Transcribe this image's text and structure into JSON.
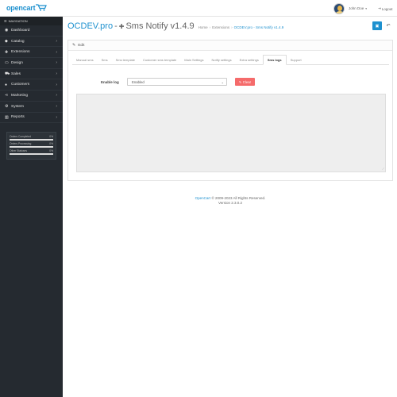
{
  "header": {
    "logo": "opencart",
    "user_name": "John Doe",
    "logout_label": "Logout"
  },
  "sidebar": {
    "nav_title": "NAVIGATION",
    "items": [
      {
        "label": "Dashboard",
        "icon": "dashboard-icon",
        "has_children": false
      },
      {
        "label": "Catalog",
        "icon": "tag-icon",
        "has_children": true
      },
      {
        "label": "Extensions",
        "icon": "puzzle-icon",
        "has_children": true
      },
      {
        "label": "Design",
        "icon": "monitor-icon",
        "has_children": true
      },
      {
        "label": "Sales",
        "icon": "cart-icon",
        "has_children": true
      },
      {
        "label": "Customers",
        "icon": "user-icon",
        "has_children": true
      },
      {
        "label": "Marketing",
        "icon": "share-icon",
        "has_children": true
      },
      {
        "label": "System",
        "icon": "cog-icon",
        "has_children": true
      },
      {
        "label": "Reports",
        "icon": "bar-chart-icon",
        "has_children": true
      }
    ],
    "stats": [
      {
        "label": "Orders Completed",
        "value": "0%",
        "progress": 0
      },
      {
        "label": "Orders Processing",
        "value": "0%",
        "progress": 0
      },
      {
        "label": "Other Statuses",
        "value": "0%",
        "progress": 0
      }
    ]
  },
  "page": {
    "title_brand": "OCDEV.pro",
    "title_sep": "-",
    "title_rest": "Sms Notify v1.4.9",
    "breadcrumb": [
      "Home",
      "Extensions",
      "OCDEV.pro - Sms Notify v1.4.9"
    ]
  },
  "panel": {
    "heading": "Edit",
    "tabs": [
      {
        "label": "Manual sms",
        "active": false
      },
      {
        "label": "Sms",
        "active": false
      },
      {
        "label": "Sms template",
        "active": false
      },
      {
        "label": "Customer sms template",
        "active": false
      },
      {
        "label": "Main Settings",
        "active": false
      },
      {
        "label": "Notify settings",
        "active": false
      },
      {
        "label": "Extra settings",
        "active": false
      },
      {
        "label": "Sms logs",
        "active": true
      },
      {
        "label": "Support",
        "active": false
      }
    ],
    "enable_log_label": "Enable log",
    "enable_log_value": "Enabled",
    "clear_label": "Clear",
    "log_content": ""
  },
  "footer": {
    "link": "OpenCart",
    "copyright": "© 2009-2023 All Rights Reserved.",
    "version": "Version 2.3.0.2"
  },
  "colors": {
    "accent": "#1e91cf",
    "sidebar_bg": "#252a30",
    "danger": "#f56b6b"
  }
}
